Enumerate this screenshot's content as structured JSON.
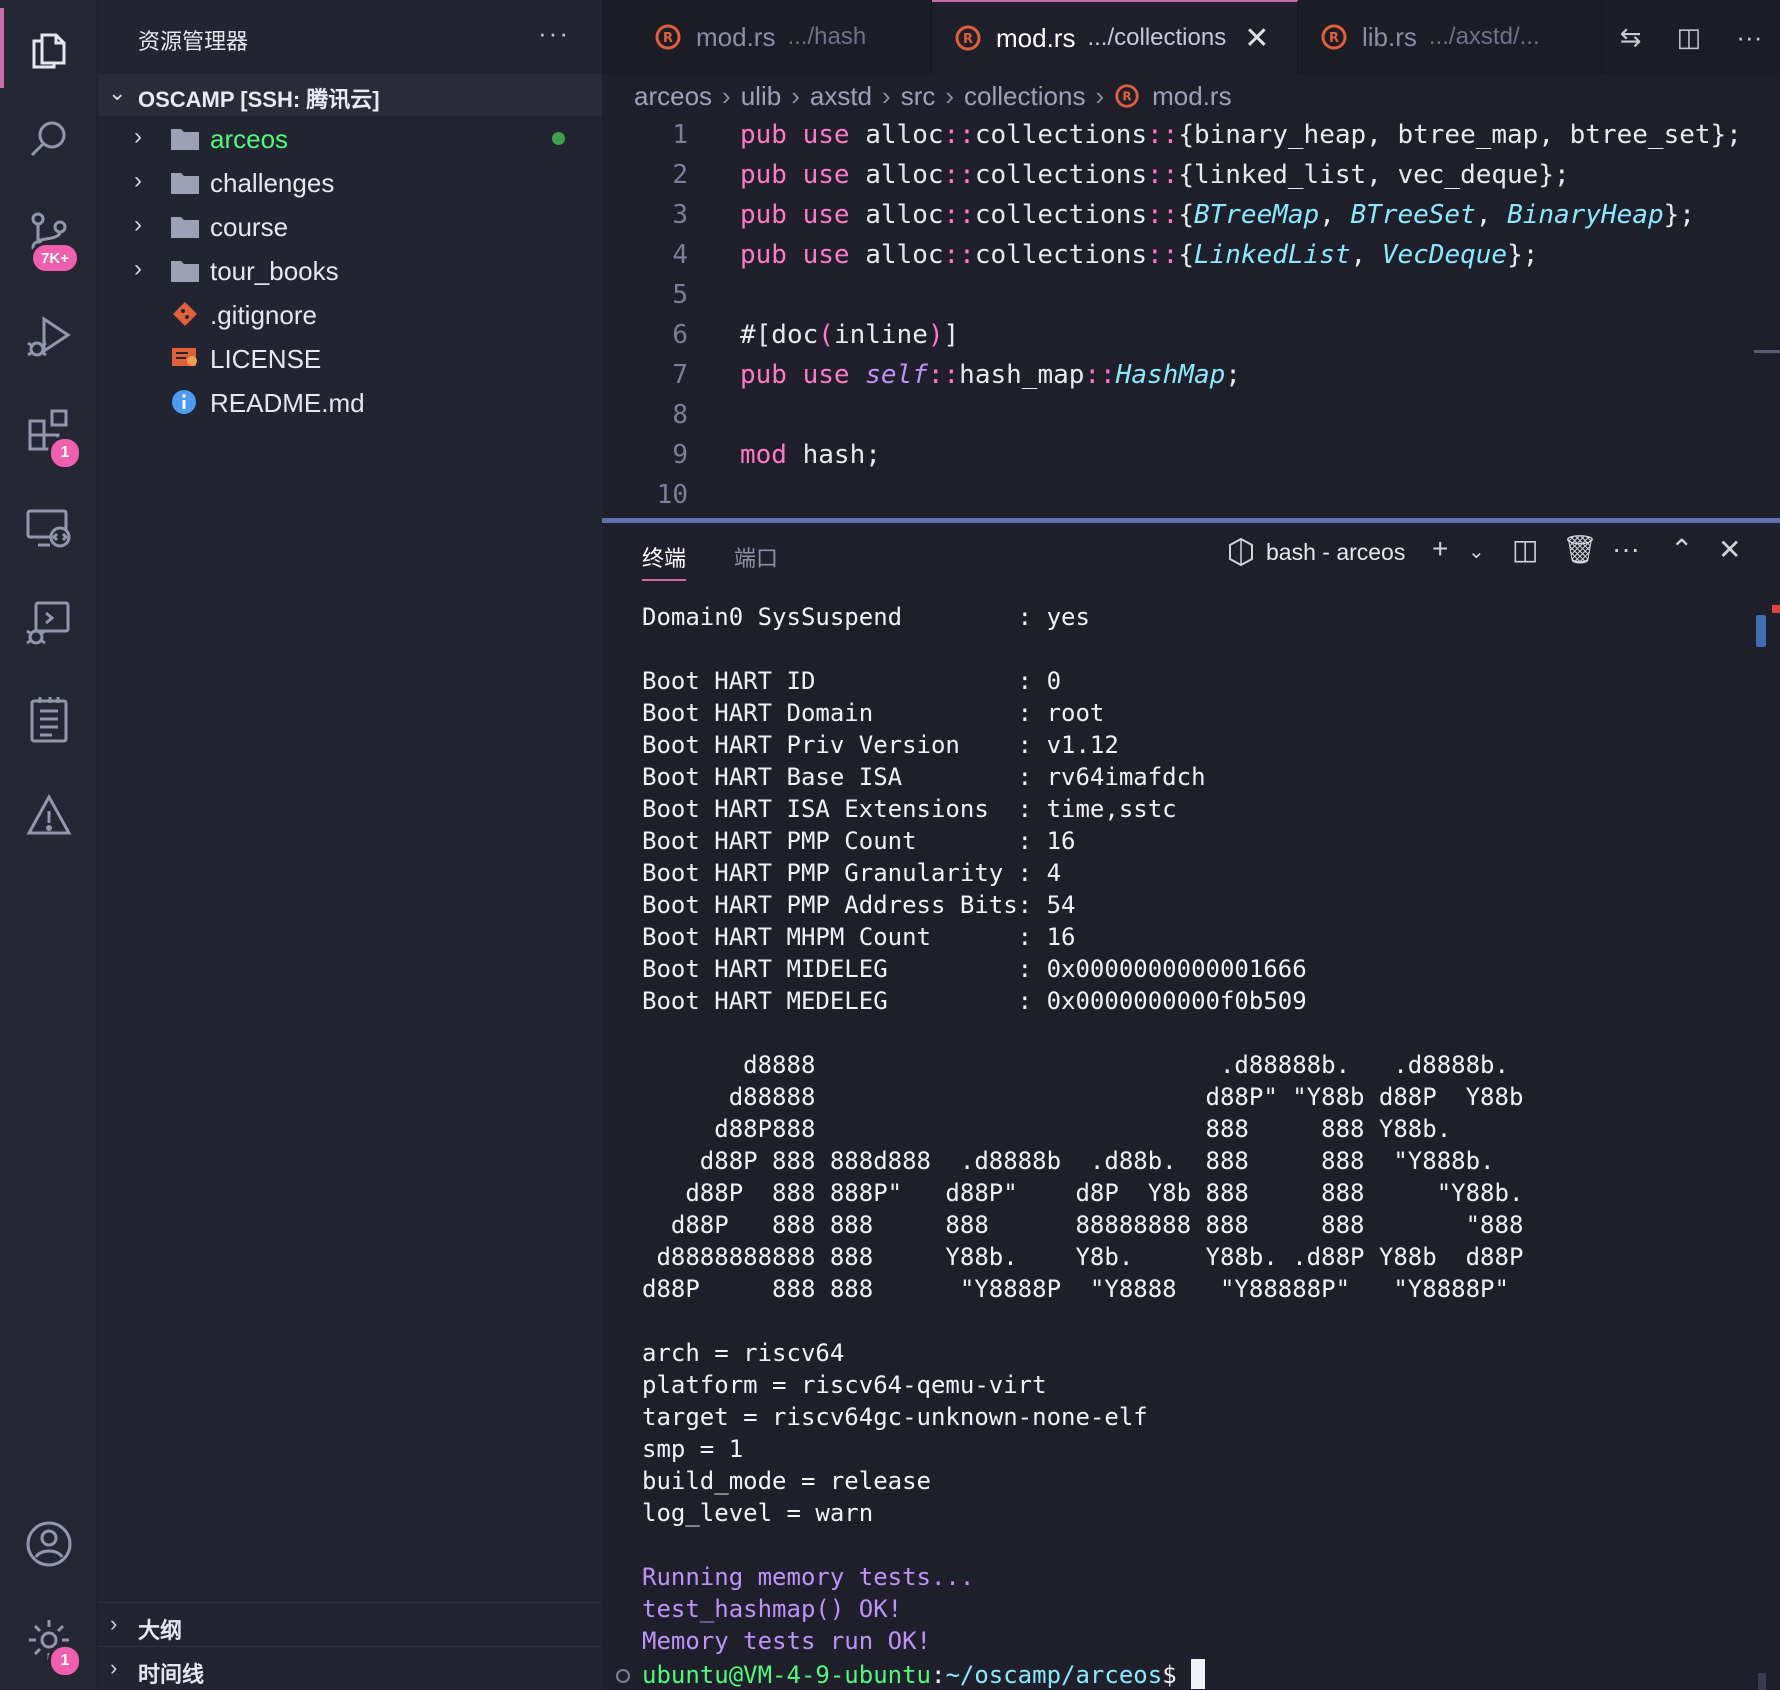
{
  "activity_bar": {
    "items": [
      {
        "name": "explorer",
        "icon": "files-icon"
      },
      {
        "name": "search",
        "icon": "search-icon"
      },
      {
        "name": "source-control",
        "icon": "source-control-icon",
        "badge": "7K+"
      },
      {
        "name": "run-debug",
        "icon": "run-debug-icon"
      },
      {
        "name": "extensions",
        "icon": "extensions-icon",
        "badge": "1"
      },
      {
        "name": "remote-explorer",
        "icon": "remote-explorer-icon"
      },
      {
        "name": "debug-console",
        "icon": "debug-console-icon"
      },
      {
        "name": "notes",
        "icon": "notebook-icon"
      },
      {
        "name": "problems",
        "icon": "warning-icon"
      }
    ],
    "account_icon": "account-icon",
    "settings_icon": "gear-icon",
    "settings_badge": "1",
    "accent": "#c96ba7"
  },
  "sidebar": {
    "title": "资源管理器",
    "more": "···",
    "root_label": "OSCAMP [SSH: 腾讯云]",
    "items": [
      {
        "label": "arceos",
        "type": "folder",
        "modified": true
      },
      {
        "label": "challenges",
        "type": "folder"
      },
      {
        "label": "course",
        "type": "folder"
      },
      {
        "label": "tour_books",
        "type": "folder"
      },
      {
        "label": ".gitignore",
        "type": "git-file"
      },
      {
        "label": "LICENSE",
        "type": "license-file"
      },
      {
        "label": "README.md",
        "type": "info-file"
      }
    ],
    "outline_label": "大纲",
    "timeline_label": "时间线"
  },
  "editor": {
    "tabs": [
      {
        "name": "mod.rs",
        "path": ".../hash",
        "active": false
      },
      {
        "name": "mod.rs",
        "path": ".../collections",
        "active": true
      },
      {
        "name": "lib.rs",
        "path": ".../axstd/...",
        "active": false
      }
    ],
    "close_glyph": "✕",
    "breadcrumb": [
      "arceos",
      "ulib",
      "axstd",
      "src",
      "collections",
      "mod.rs"
    ],
    "lines": [
      "1",
      "2",
      "3",
      "4",
      "5",
      "6",
      "7",
      "8",
      "9",
      "10"
    ]
  },
  "panel": {
    "tabs": [
      "终端",
      "端口"
    ],
    "terminal_name": "bash - arceos",
    "terminal_output": [
      "Domain0 SysSuspend        : yes",
      "",
      "Boot HART ID              : 0",
      "Boot HART Domain          : root",
      "Boot HART Priv Version    : v1.12",
      "Boot HART Base ISA        : rv64imafdch",
      "Boot HART ISA Extensions  : time,sstc",
      "Boot HART PMP Count       : 16",
      "Boot HART PMP Granularity : 4",
      "Boot HART PMP Address Bits: 54",
      "Boot HART MHPM Count      : 16",
      "Boot HART MIDELEG         : 0x0000000000001666",
      "Boot HART MEDELEG         : 0x0000000000f0b509",
      "",
      "       d8888                            .d88888b.   .d8888b.",
      "      d88888                           d88P\" \"Y88b d88P  Y88b",
      "     d88P888                           888     888 Y88b.",
      "    d88P 888 888d888  .d8888b  .d88b.  888     888  \"Y888b.",
      "   d88P  888 888P\"   d88P\"    d8P  Y8b 888     888     \"Y88b.",
      "  d88P   888 888     888      88888888 888     888       \"888",
      " d8888888888 888     Y88b.    Y8b.     Y88b. .d88P Y88b  d88P",
      "d88P     888 888      \"Y8888P  \"Y8888   \"Y88888P\"   \"Y8888P\"",
      "",
      "arch = riscv64",
      "platform = riscv64-qemu-virt",
      "target = riscv64gc-unknown-none-elf",
      "smp = 1",
      "build_mode = release",
      "log_level = warn",
      ""
    ],
    "test_output": [
      "Running memory tests...",
      "test_hashmap() OK!",
      "Memory tests run OK!"
    ],
    "prompt_user": "ubuntu@VM-4-9-ubuntu",
    "prompt_sep": ":",
    "prompt_path": "~/oscamp/arceos",
    "prompt_end": "$ "
  }
}
